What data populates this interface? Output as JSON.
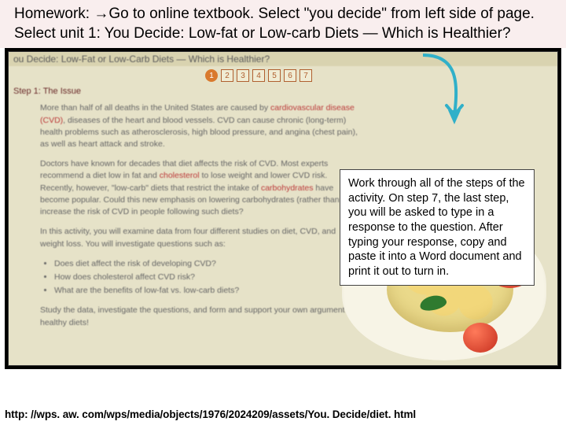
{
  "banner": {
    "label": "Homework:",
    "arrow_glyph": "→",
    "text": "Go to online textbook.  Select \"you decide\" from left side of page.  Select unit 1: You Decide: Low-fat or Low-carb Diets — Which is Healthier?"
  },
  "browser": {
    "page_title": "ou Decide: Low-Fat or Low-Carb Diets — Which is Healthier?",
    "step_label": "Step 1: The Issue",
    "tabs": [
      "1",
      "2",
      "3",
      "4",
      "5",
      "6",
      "7"
    ],
    "active_tab": "1",
    "para1_a": "More than half of all deaths in the United States are caused by ",
    "para1_link1": "cardiovascular disease (CVD)",
    "para1_b": ", diseases of the heart and blood vessels. CVD can cause chronic (long-term) health problems such as atherosclerosis, high blood pressure, and angina (chest pain), as well as heart attack and stroke.",
    "para2_a": "Doctors have known for decades that diet affects the risk of CVD. Most experts recommend a diet low in fat and ",
    "para2_link1": "cholesterol",
    "para2_b": " to lose weight and lower CVD risk. Recently, however, \"low-carb\" diets that restrict the intake of ",
    "para2_link2": "carbohydrates",
    "para2_c": " have become popular. Could this new emphasis on lowering carbohydrates (rather than fats) increase the risk of CVD in people following such diets?",
    "para3": "In this activity, you will examine data from four different studies on diet, CVD, and weight loss. You will investigate questions such as:",
    "bullets": [
      "Does diet affect the risk of developing CVD?",
      "How does cholesterol affect CVD risk?",
      "What are the benefits of low-fat vs. low-carb diets?"
    ],
    "para4": "Study the data, investigate the questions, and form and support your own argument on healthy diets!"
  },
  "callout": {
    "text": "Work through all of the steps of the activity.  On step 7, the last step, you will be asked to type in a response to the question.  After typing your response, copy and paste it into a Word document and print it out to turn in."
  },
  "footer": {
    "url": "http: //wps. aw. com/wps/media/objects/1976/2024209/assets/You. Decide/diet. html"
  },
  "colors": {
    "banner_bg": "#f9eeee",
    "arrow": "#30b0c9"
  }
}
